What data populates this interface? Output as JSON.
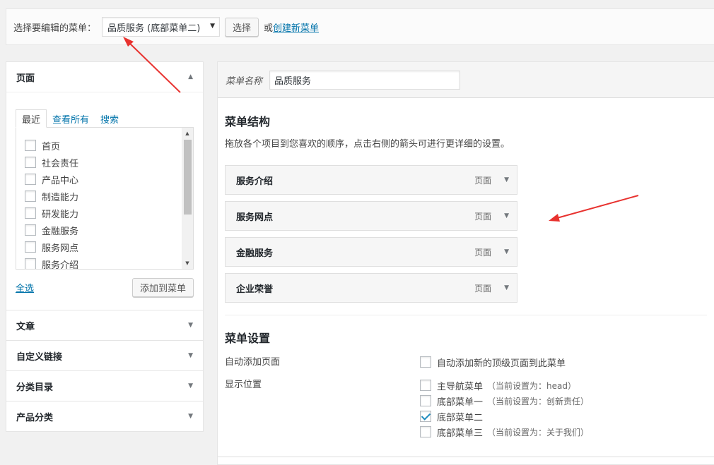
{
  "topbar": {
    "label": "选择要编辑的菜单：",
    "selected_menu": "品质服务 (底部菜单二)",
    "select_button": "选择",
    "or_text": "或",
    "create_link": "创建新菜单"
  },
  "pages_box": {
    "title": "页面",
    "tabs": [
      "最近",
      "查看所有",
      "搜索"
    ],
    "items": [
      "首页",
      "社会责任",
      "产品中心",
      "制造能力",
      "研发能力",
      "金融服务",
      "服务网点",
      "服务介绍"
    ],
    "select_all": "全选",
    "add_button": "添加到菜单"
  },
  "collapsed_boxes": [
    "文章",
    "自定义链接",
    "分类目录",
    "产品分类"
  ],
  "menu_name": {
    "label": "菜单名称",
    "value": "品质服务"
  },
  "structure": {
    "title": "菜单结构",
    "description": "拖放各个项目到您喜欢的顺序，点击右侧的箭头可进行更详细的设置。",
    "items": [
      {
        "title": "服务介绍",
        "type": "页面"
      },
      {
        "title": "服务网点",
        "type": "页面"
      },
      {
        "title": "金融服务",
        "type": "页面"
      },
      {
        "title": "企业荣誉",
        "type": "页面"
      }
    ]
  },
  "settings": {
    "title": "菜单设置",
    "auto_add_label": "自动添加页面",
    "auto_add_option": "自动添加新的顶级页面到此菜单",
    "location_label": "显示位置",
    "locations": [
      {
        "name": "主导航菜单",
        "note": "（当前设置为：head）",
        "checked": false
      },
      {
        "name": "底部菜单一",
        "note": "（当前设置为：创新责任）",
        "checked": false
      },
      {
        "name": "底部菜单二",
        "note": "",
        "checked": true
      },
      {
        "name": "底部菜单三",
        "note": "（当前设置为：关于我们）",
        "checked": false
      }
    ]
  },
  "colors": {
    "link": "#0073aa",
    "annotation": "#e8322f"
  }
}
